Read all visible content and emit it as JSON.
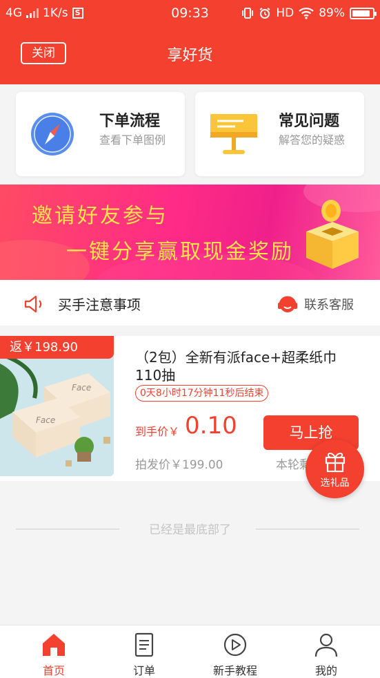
{
  "status_bar": {
    "network": "4G",
    "speed": "1K/s",
    "time": "09:33",
    "hd": "HD",
    "battery_text": "89%",
    "battery_level": 0.89
  },
  "nav": {
    "close_label": "关闭",
    "title": "享好货"
  },
  "cards": [
    {
      "title": "下单流程",
      "desc": "查看下单图例",
      "icon": "compass-icon"
    },
    {
      "title": "常见问题",
      "desc": "解答您的疑惑",
      "icon": "easel-board-icon"
    }
  ],
  "banner": {
    "line1": "邀请好友参与",
    "line2": "一键分享赢取现金奖励"
  },
  "notice": {
    "text": "买手注意事项",
    "service": "联系客服"
  },
  "product": {
    "rebate": "返￥198.90",
    "title": "（2包）全新有派face+超柔纸巾110抽",
    "countdown": "0天8小时17分钟11秒后结束",
    "price_label": "到手价￥",
    "price": "0.10",
    "buy_label": "马上抢",
    "wholesale": "拍发价￥199.00",
    "round_text": "本轮剩",
    "image_brand": "Face"
  },
  "gift_fab": {
    "label": "选礼品"
  },
  "end_text": "已经是最底部了",
  "tabs": [
    {
      "label": "首页",
      "icon": "home-icon",
      "active": true
    },
    {
      "label": "订单",
      "icon": "order-icon",
      "active": false
    },
    {
      "label": "新手教程",
      "icon": "play-icon",
      "active": false
    },
    {
      "label": "我的",
      "icon": "user-icon",
      "active": false
    }
  ],
  "colors": {
    "brand_red": "#f3402f",
    "banner_text": "#ffe34a"
  }
}
